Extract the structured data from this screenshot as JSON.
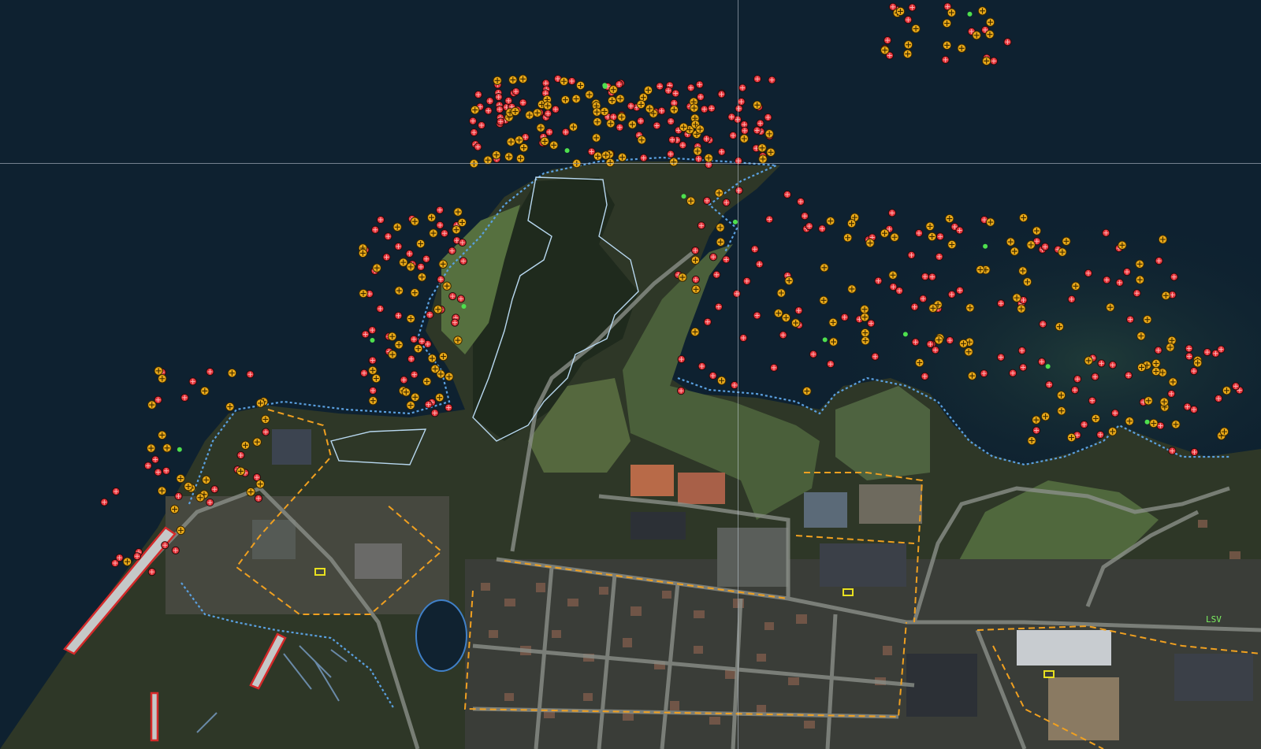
{
  "map": {
    "type": "aerial-ortho-map",
    "label_text": "LSV",
    "symbols": {
      "hazard_marker": {
        "color": "#e4343b",
        "icon": "red-hazard-icon"
      },
      "sign_marker": {
        "color": "#e8a818",
        "icon": "yellow-cross-icon"
      },
      "point_marker": {
        "color": "#4ee04e",
        "icon": "green-point-icon"
      },
      "shoreline": {
        "color": "#5aa0e0"
      },
      "boundary": {
        "color": "#f0a020"
      },
      "pier": {
        "color": "#d42a2a"
      },
      "park_outline": {
        "color": "#b8d8f0"
      }
    },
    "colors": {
      "water": "#0e2130",
      "land": "#2f3a28",
      "grass": "#4f6a3a",
      "road": "#8a8f88",
      "roof": "#3b4048",
      "roof_red": "#b86a48"
    }
  }
}
